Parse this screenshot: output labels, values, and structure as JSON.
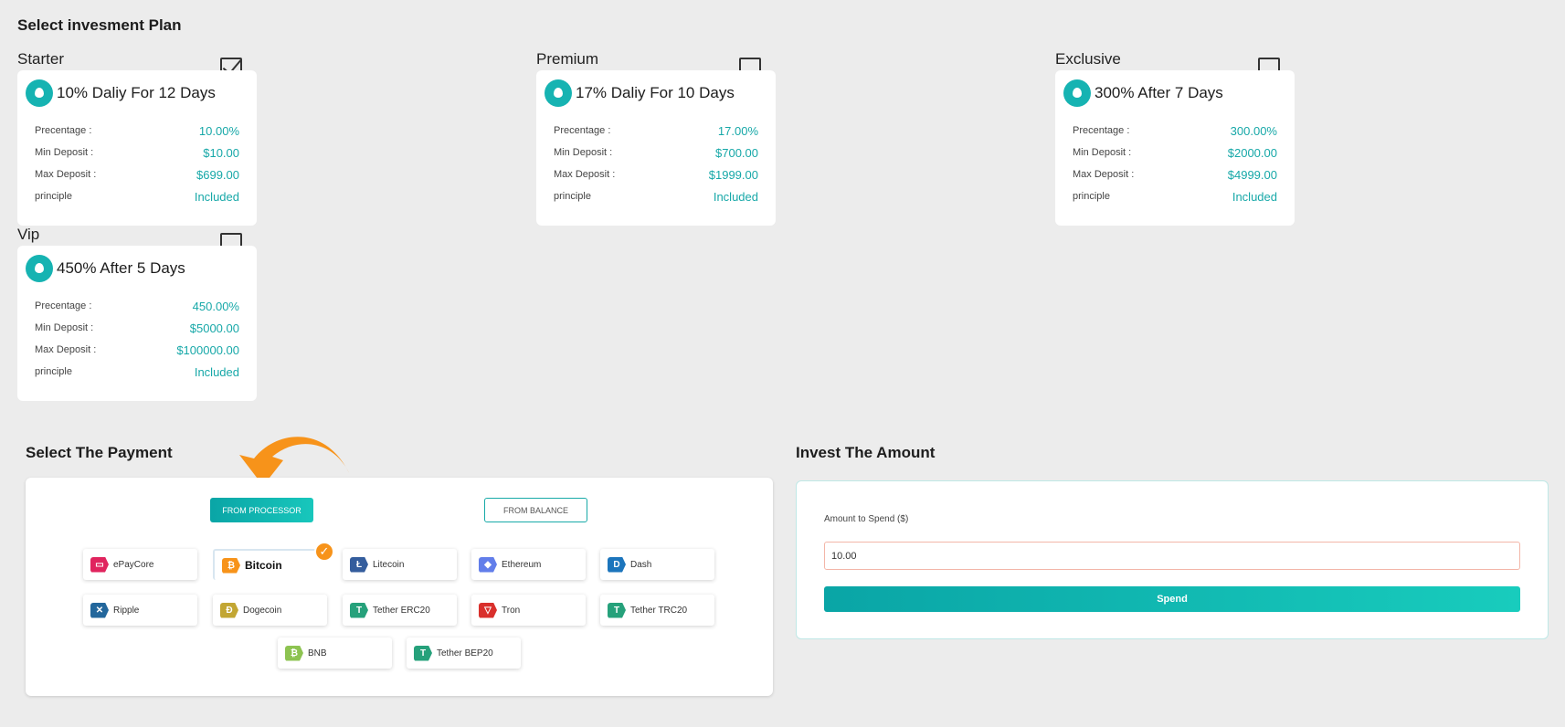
{
  "plan_section": {
    "title": "Select invesment Plan"
  },
  "plans": [
    {
      "label": "Starter",
      "checked": true,
      "title": "10% Daliy For 12 Days",
      "rows": [
        {
          "k": "Precentage :",
          "v": "10.00%"
        },
        {
          "k": "Min Deposit :",
          "v": "$10.00"
        },
        {
          "k": "Max Deposit :",
          "v": "$699.00"
        },
        {
          "k": "principle",
          "v": "Included"
        }
      ]
    },
    {
      "label": "Premium",
      "checked": false,
      "title": "17% Daliy For 10 Days",
      "rows": [
        {
          "k": "Precentage :",
          "v": "17.00%"
        },
        {
          "k": "Min Deposit :",
          "v": "$700.00"
        },
        {
          "k": "Max Deposit :",
          "v": "$1999.00"
        },
        {
          "k": "principle",
          "v": "Included"
        }
      ]
    },
    {
      "label": "Exclusive",
      "checked": false,
      "title": "300% After 7 Days",
      "rows": [
        {
          "k": "Precentage :",
          "v": "300.00%"
        },
        {
          "k": "Min Deposit :",
          "v": "$2000.00"
        },
        {
          "k": "Max Deposit :",
          "v": "$4999.00"
        },
        {
          "k": "principle",
          "v": "Included"
        }
      ]
    },
    {
      "label": "Vip",
      "checked": false,
      "title": "450% After 5 Days",
      "rows": [
        {
          "k": "Precentage :",
          "v": "450.00%"
        },
        {
          "k": "Min Deposit :",
          "v": "$5000.00"
        },
        {
          "k": "Max Deposit :",
          "v": "$100000.00"
        },
        {
          "k": "principle",
          "v": "Included"
        }
      ]
    }
  ],
  "payment": {
    "title": "Select The Payment",
    "from_processor": "FROM PROCESSOR",
    "from_balance": "FROM BALANCE",
    "methods": [
      {
        "label": "ePayCore",
        "color": "#e0245e",
        "glyph": "▭",
        "selected": false
      },
      {
        "label": "Bitcoin",
        "color": "#f7931a",
        "glyph": "₿",
        "selected": true
      },
      {
        "label": "Litecoin",
        "color": "#345d9d",
        "glyph": "Ł",
        "selected": false
      },
      {
        "label": "Ethereum",
        "color": "#627eea",
        "glyph": "◆",
        "selected": false
      },
      {
        "label": "Dash",
        "color": "#1c75bc",
        "glyph": "D",
        "selected": false
      },
      {
        "label": "Ripple",
        "color": "#23679c",
        "glyph": "✕",
        "selected": false
      },
      {
        "label": "Dogecoin",
        "color": "#c2a633",
        "glyph": "Ð",
        "selected": false
      },
      {
        "label": "Tether ERC20",
        "color": "#26a17b",
        "glyph": "T",
        "selected": false
      },
      {
        "label": "Tron",
        "color": "#d9302c",
        "glyph": "▽",
        "selected": false
      },
      {
        "label": "Tether TRC20",
        "color": "#26a17b",
        "glyph": "T",
        "selected": false
      },
      {
        "label": "BNB",
        "color": "#8dc351",
        "glyph": "₿",
        "selected": false
      },
      {
        "label": "Tether BEP20",
        "color": "#26a17b",
        "glyph": "T",
        "selected": false
      }
    ],
    "selected_mark": "✓"
  },
  "invest": {
    "title": "Invest The Amount",
    "amount_label": "Amount to Spend ($)",
    "amount_value": "10.00",
    "spend_label": "Spend"
  },
  "colors": {
    "accent": "#17a8a8",
    "arrow": "#f7931a"
  }
}
